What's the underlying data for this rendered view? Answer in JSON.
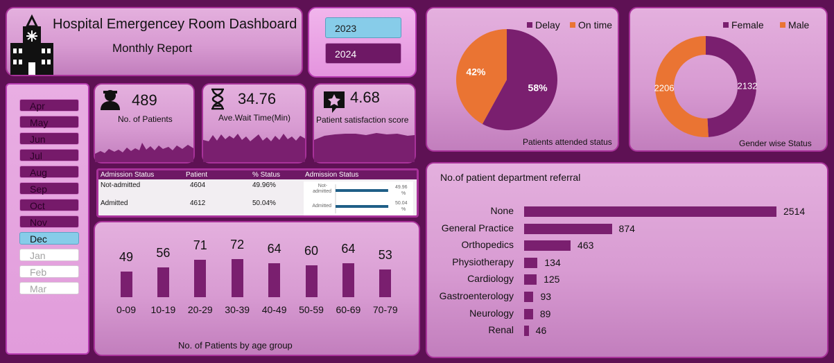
{
  "header": {
    "title": "Hospital Emergencey Room Dashboard",
    "subtitle": "Monthly Report"
  },
  "years": [
    {
      "label": "2023",
      "state": "selected"
    },
    {
      "label": "2024",
      "state": "active"
    }
  ],
  "months": [
    {
      "label": "Apr",
      "state": "on"
    },
    {
      "label": "May",
      "state": "on"
    },
    {
      "label": "Jun",
      "state": "on"
    },
    {
      "label": "Jul",
      "state": "on"
    },
    {
      "label": "Aug",
      "state": "on"
    },
    {
      "label": "Sep",
      "state": "on"
    },
    {
      "label": "Oct",
      "state": "on"
    },
    {
      "label": "Nov",
      "state": "on"
    },
    {
      "label": "Dec",
      "state": "selected"
    },
    {
      "label": "Jan",
      "state": "off"
    },
    {
      "label": "Feb",
      "state": "off"
    },
    {
      "label": "Mar",
      "state": "off"
    }
  ],
  "kpis": {
    "patients": {
      "value": "489",
      "label": "No. of Patients",
      "icon": "user-icon"
    },
    "wait": {
      "value": "34.76",
      "label": "Ave.Wait Time(Min)",
      "icon": "hourglass-icon"
    },
    "satisfaction": {
      "value": "4.68",
      "label": "Patient satisfaction score",
      "icon": "star-icon"
    }
  },
  "admission_table": {
    "headers": [
      "Admission Status",
      "Patient",
      "% Status",
      "Admission Status"
    ],
    "rows": [
      {
        "status": "Not-admitted",
        "patients": "4604",
        "pct": "49.96%",
        "chart_label": "Not-admitted",
        "chart_value": "49.96 %",
        "share": 0.4996
      },
      {
        "status": "Admitted",
        "patients": "4612",
        "pct": "50.04%",
        "chart_label": "Admitted",
        "chart_value": "50.04 %",
        "share": 0.5004
      }
    ]
  },
  "colors": {
    "purple": "#7a1f6f",
    "orange": "#ea7433",
    "accent_blue": "#87cce9",
    "mini_bar": "#1f5f87"
  },
  "chart_data": [
    {
      "type": "bar",
      "title": "No. of Patients by age group",
      "categories": [
        "0-09",
        "10-19",
        "20-29",
        "30-39",
        "40-49",
        "50-59",
        "60-69",
        "70-79"
      ],
      "values": [
        49,
        56,
        71,
        72,
        64,
        60,
        64,
        53
      ],
      "ylim": [
        0,
        72
      ]
    },
    {
      "type": "pie",
      "title": "Patients attended status",
      "labels": [
        "Delay",
        "On time"
      ],
      "values": [
        58,
        42
      ],
      "value_labels": [
        "58%",
        "42%"
      ],
      "legend": "top"
    },
    {
      "type": "pie",
      "title": "Gender wise Status",
      "labels": [
        "Female",
        "Male"
      ],
      "values": [
        2132,
        2206
      ],
      "value_labels": [
        "2132",
        "2206"
      ],
      "legend": "top",
      "donut": true
    },
    {
      "type": "bar",
      "title": "No.of patient department referral",
      "orientation": "horizontal",
      "categories": [
        "None",
        "General Practice",
        "Orthopedics",
        "Physiotherapy",
        "Cardiology",
        "Gastroenterology",
        "Neurology",
        "Renal"
      ],
      "values": [
        2514,
        874,
        463,
        134,
        125,
        93,
        89,
        46
      ],
      "xlim": [
        0,
        2514
      ]
    }
  ]
}
